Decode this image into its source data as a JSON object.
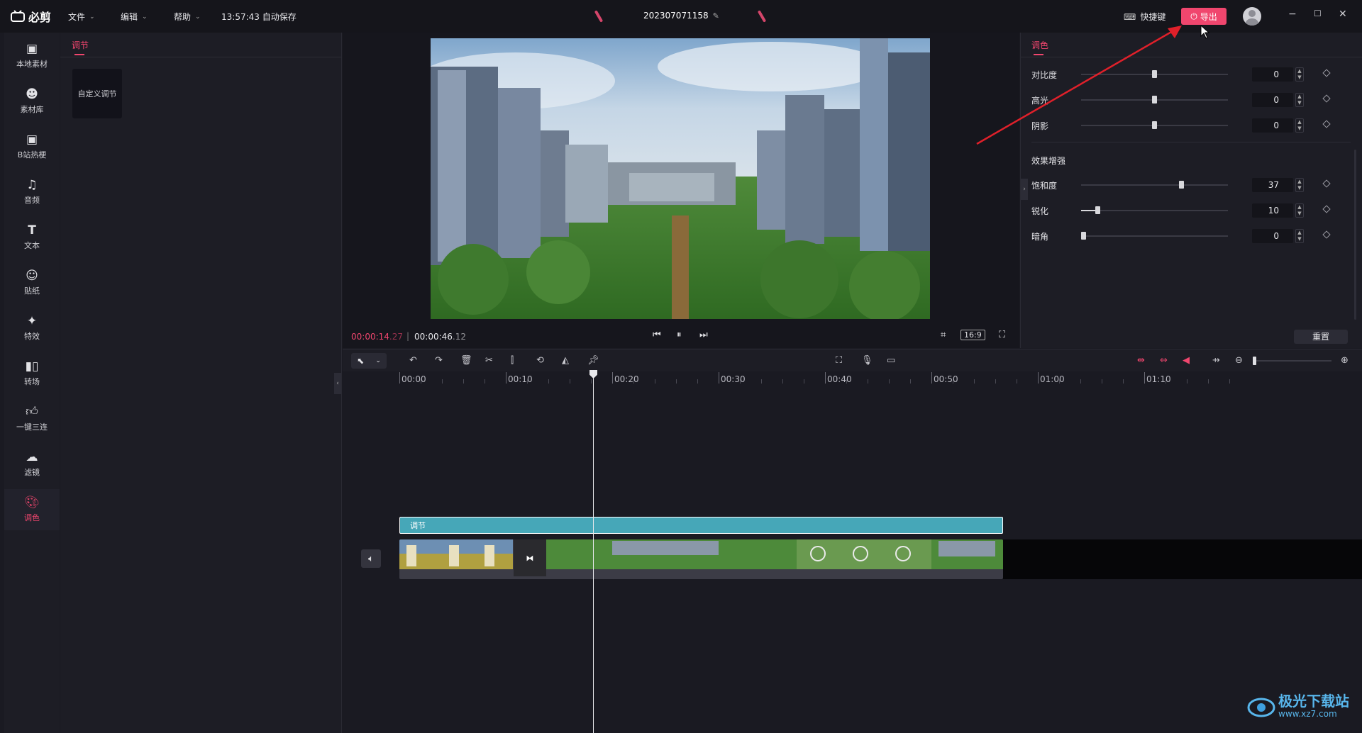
{
  "app": {
    "logo": "必剪",
    "menus": [
      {
        "label": "文件"
      },
      {
        "label": "编辑"
      },
      {
        "label": "帮助"
      }
    ],
    "autosave": "13:57:43 自动保存",
    "project_title": "202307071158",
    "shortcut_label": "快捷键",
    "export_label": "导出"
  },
  "leftnav": {
    "items": [
      {
        "label": "本地素材",
        "icon": "folder-upload-icon"
      },
      {
        "label": "素材库",
        "icon": "robot-face-icon"
      },
      {
        "label": "B站热梗",
        "icon": "tv-icon"
      },
      {
        "label": "音频",
        "icon": "music-note-icon"
      },
      {
        "label": "文本",
        "icon": "text-t-icon"
      },
      {
        "label": "贴纸",
        "icon": "sticker-icon"
      },
      {
        "label": "特效",
        "icon": "sparkle-icon"
      },
      {
        "label": "转场",
        "icon": "transition-icon"
      },
      {
        "label": "一键三连",
        "icon": "thumbs-up-icon"
      },
      {
        "label": "滤镜",
        "icon": "filter-icon"
      },
      {
        "label": "调色",
        "icon": "palette-icon",
        "active": true
      }
    ]
  },
  "adjust_panel": {
    "tab": "调节",
    "custom_card": "自定义调节"
  },
  "preview": {
    "current_time": "00:00:14",
    "current_frames": ".27",
    "total_time": "00:00:46",
    "total_frames": ".12",
    "ratio": "16:9"
  },
  "color_panel": {
    "tab": "调色",
    "params": [
      {
        "label": "对比度",
        "value": "0",
        "level": 0.5
      },
      {
        "label": "高光",
        "value": "0",
        "level": 0.5
      },
      {
        "label": "阴影",
        "value": "0",
        "level": 0.5
      }
    ],
    "section_title": "效果增强",
    "enhance_params": [
      {
        "label": "饱和度",
        "value": "37",
        "level": 0.69
      },
      {
        "label": "锐化",
        "value": "10",
        "level": 0.1
      },
      {
        "label": "暗角",
        "value": "0",
        "level": 0.0
      }
    ],
    "reset_label": "重置"
  },
  "timeline": {
    "ruler": [
      "00:00",
      "00:10",
      "00:20",
      "00:30",
      "00:40",
      "00:50",
      "01:00",
      "01:10"
    ],
    "adjust_clip_label": "调节"
  },
  "watermark": {
    "title": "极光下载站",
    "url": "www.xz7.com"
  },
  "colors": {
    "accent": "#f0466e",
    "adjust_clip": "#46a7b8",
    "annotation_arrow": "#e0202a"
  }
}
